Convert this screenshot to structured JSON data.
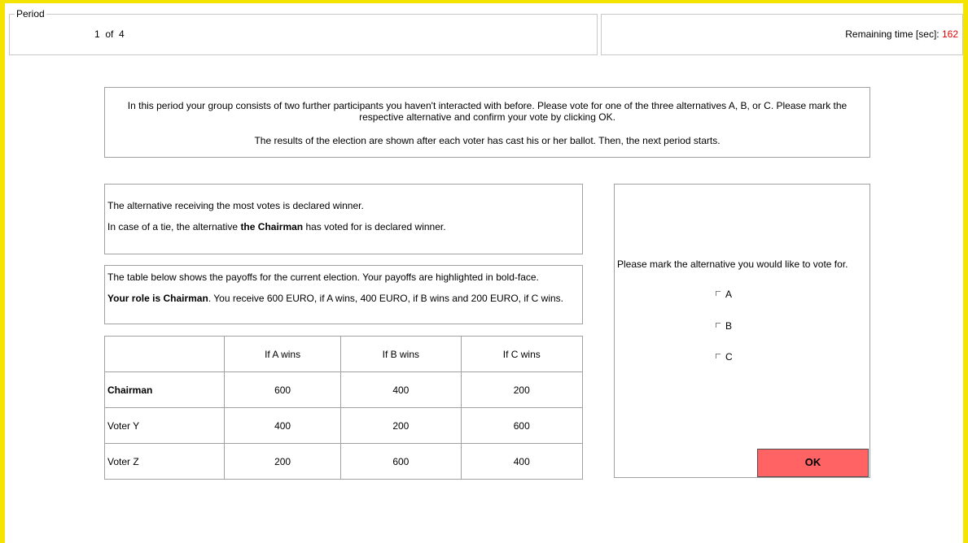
{
  "header": {
    "period_legend": "Period",
    "period_value": "1  of  4",
    "remaining_label": "Remaining time [sec]:",
    "remaining_value": "162"
  },
  "info": {
    "para1": "In this period your group consists of two further participants you haven't interacted with before. Please vote for one of the three alternatives A, B, or C. Please mark the respective alternative and confirm your vote by clicking OK.",
    "para2": "The results of the election are shown after each voter has cast his or her ballot. Then, the next period starts."
  },
  "rules": {
    "line1": "The alternative receiving the most votes is declared winner.",
    "line2_pre": "In case of a tie, the alternative ",
    "line2_bold": "the Chairman",
    "line2_post": " has voted for is declared winner."
  },
  "payoff_info": {
    "line1": "The table below shows the payoffs for the current election. Your payoffs are highlighted in bold-face.",
    "line2_bold": "Your role is Chairman",
    "line2_rest": ". You receive 600 EURO, if A wins, 400 EURO, if B wins and 200 EURO, if C wins."
  },
  "table": {
    "headers": [
      "",
      "If A wins",
      "If B wins",
      "If C wins"
    ],
    "rows": [
      {
        "label": "Chairman",
        "values": [
          "600",
          "400",
          "200"
        ]
      },
      {
        "label": "Voter Y",
        "values": [
          "400",
          "200",
          "600"
        ]
      },
      {
        "label": "Voter Z",
        "values": [
          "200",
          "600",
          "400"
        ]
      }
    ]
  },
  "vote": {
    "prompt": "Please mark the alternative you would like to vote for.",
    "options": [
      "A",
      "B",
      "C"
    ],
    "ok_label": "OK"
  },
  "colors": {
    "frame": "#f5e400",
    "ok_button": "#ff6363",
    "time_value": "#e00000"
  }
}
